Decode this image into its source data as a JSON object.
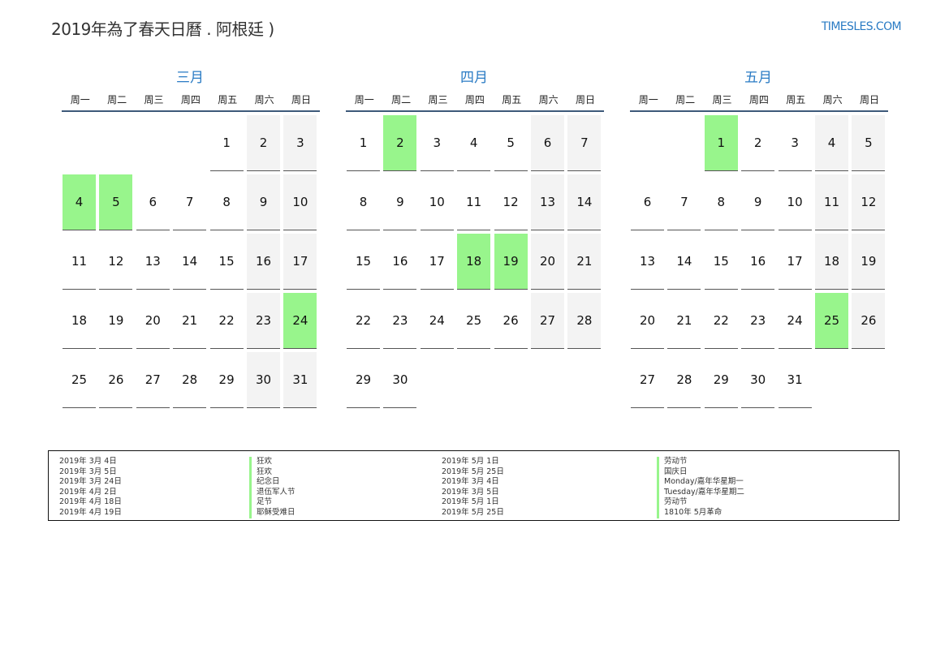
{
  "header": {
    "title": "2019年為了春天日曆 . 阿根廷 )",
    "site": "TIMESLES.COM"
  },
  "colors": {
    "accent": "#2a7bc4",
    "holiday": "#98f58c",
    "weekend": "#f3f3f3"
  },
  "weekdays": [
    "周一",
    "周二",
    "周三",
    "周四",
    "周五",
    "周六",
    "周日"
  ],
  "months": [
    {
      "name": "三月",
      "first_weekday": 4,
      "days": 31,
      "holidays": [
        4,
        5,
        24
      ]
    },
    {
      "name": "四月",
      "first_weekday": 0,
      "days": 30,
      "holidays": [
        2,
        18,
        19
      ]
    },
    {
      "name": "五月",
      "first_weekday": 2,
      "days": 31,
      "holidays": [
        1,
        25
      ]
    }
  ],
  "legend": {
    "left": [
      {
        "date": "2019年 3月 4日",
        "name": "狂欢"
      },
      {
        "date": "2019年 3月 5日",
        "name": "狂欢"
      },
      {
        "date": "2019年 3月 24日",
        "name": "纪念日"
      },
      {
        "date": "2019年 4月 2日",
        "name": "退伍军人节"
      },
      {
        "date": "2019年 4月 18日",
        "name": "足节"
      },
      {
        "date": "2019年 4月 19日",
        "name": "耶稣受难日"
      }
    ],
    "right": [
      {
        "date": "2019年 5月 1日",
        "name": "劳动节"
      },
      {
        "date": "2019年 5月 25日",
        "name": "国庆日"
      },
      {
        "date": "2019年 3月 4日",
        "name": "Monday/嘉年华星期一"
      },
      {
        "date": "2019年 3月 5日",
        "name": "Tuesday/嘉年华星期二"
      },
      {
        "date": "2019年 5月 1日",
        "name": "劳动节"
      },
      {
        "date": "2019年 5月 25日",
        "name": "1810年 5月革命"
      }
    ]
  }
}
